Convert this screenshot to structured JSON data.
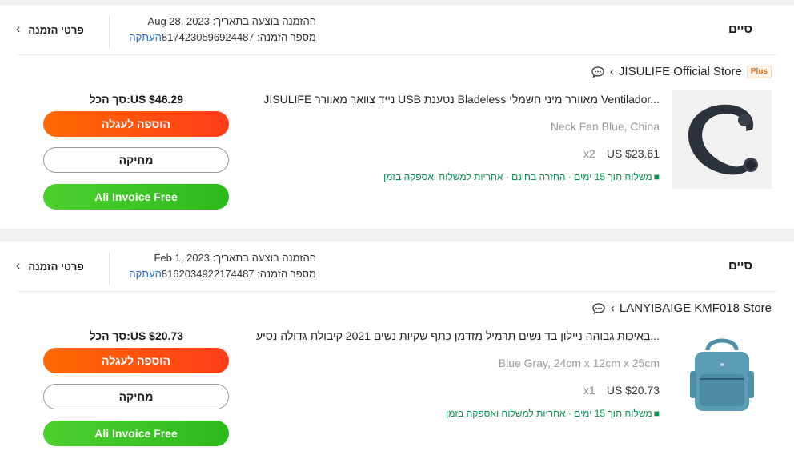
{
  "orders": [
    {
      "status": "סיים",
      "date_label": "ההזמנה בוצעה בתאריך:",
      "date": "Aug 28, 2023",
      "number_label": "מספר הזמנה:",
      "number": "8174230596924487",
      "copy": "העתקה",
      "details": "פרטי הזמנה",
      "store": "JISULIFE Official Store",
      "store_badge": "Plus",
      "title": "JISULIFE נייד צוואר מאוורר USB נטענת Bladeless מאוורר מיני חשמלי Ventilador...",
      "variant": "Neck Fan Blue, China",
      "price": "US $23.61",
      "qty": "x2",
      "shipping": "משלוח תוך 15 ימים · החזרה בחינם · אחריות למשלוח ואספקה בזמן",
      "total": "סך הכל:US $46.29",
      "add_to_cart": "הוספה לעגלה",
      "delete": "מחיקה",
      "invoice": "Ali Invoice Free"
    },
    {
      "status": "סיים",
      "date_label": "ההזמנה בוצעה בתאריך:",
      "date": "Feb 1, 2023",
      "number_label": "מספר הזמנה:",
      "number": "8162034922174487",
      "copy": "העתקה",
      "details": "פרטי הזמנה",
      "store": "LANYIBAIGE KMF018 Store",
      "title": "באיכות גבוהה ניילון בד נשים תרמיל מזדמן כתף שקיות נשים 2021 קיבולת גדולה נסיע...",
      "variant": "Blue Gray, 24cm x 12cm x 25cm",
      "price": "US $20.73",
      "qty": "x1",
      "shipping": "משלוח תוך 15 ימים · אחריות למשלוח ואספקה בזמן",
      "total": "סך הכל:US $20.73",
      "add_to_cart": "הוספה לעגלה",
      "delete": "מחיקה",
      "invoice": "Ali Invoice Free"
    }
  ],
  "colors": {
    "cart": "#ff5a0e",
    "invoice": "#3cc524",
    "link": "#1a6dd6",
    "shipping": "#0a8f4f"
  },
  "icons": [
    "chevron-left-icon",
    "chat-icon",
    "truck-icon",
    "neck-fan-image",
    "backpack-image"
  ]
}
